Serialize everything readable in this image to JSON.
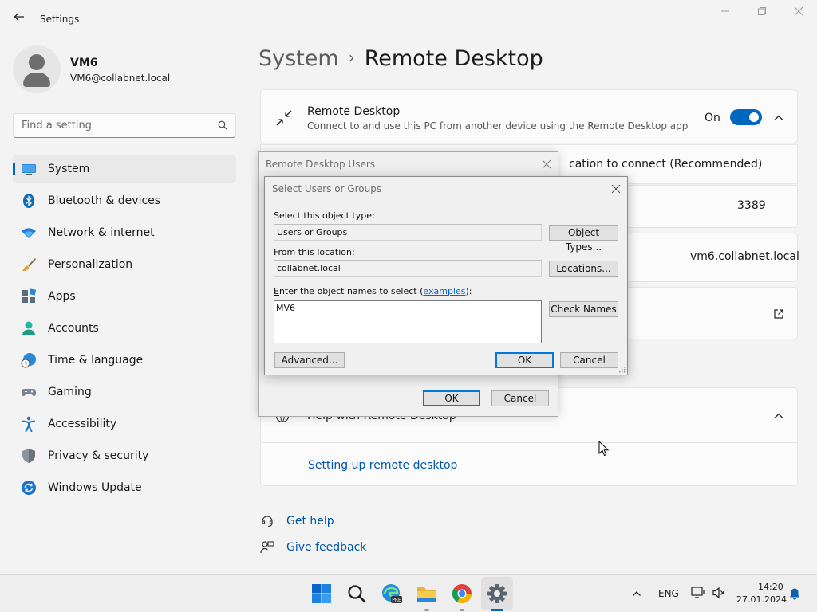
{
  "window": {
    "title": "Settings"
  },
  "profile": {
    "name": "VM6",
    "email": "VM6@collabnet.local"
  },
  "search": {
    "placeholder": "Find a setting"
  },
  "sidebar": {
    "items": [
      {
        "label": "System",
        "icon": "system-icon",
        "active": true
      },
      {
        "label": "Bluetooth & devices",
        "icon": "bluetooth-icon"
      },
      {
        "label": "Network & internet",
        "icon": "wifi-icon"
      },
      {
        "label": "Personalization",
        "icon": "brush-icon"
      },
      {
        "label": "Apps",
        "icon": "apps-icon"
      },
      {
        "label": "Accounts",
        "icon": "account-icon"
      },
      {
        "label": "Time & language",
        "icon": "clock-globe-icon"
      },
      {
        "label": "Gaming",
        "icon": "gamepad-icon"
      },
      {
        "label": "Accessibility",
        "icon": "accessibility-icon"
      },
      {
        "label": "Privacy & security",
        "icon": "shield-icon"
      },
      {
        "label": "Windows Update",
        "icon": "update-icon"
      }
    ]
  },
  "breadcrumb": {
    "parent": "System",
    "separator": "›",
    "current": "Remote Desktop"
  },
  "remote_desktop": {
    "title": "Remote Desktop",
    "description": "Connect to and use this PC from another device using the Remote Desktop app",
    "toggle_label": "On",
    "toggle_on": true
  },
  "rows": {
    "nla_partial": "cation to connect (Recommended)",
    "port": "3389",
    "pc_name": "vm6.collabnet.local"
  },
  "help_section": {
    "title_partial": "Help with Remote Desktop",
    "link": "Setting up remote desktop"
  },
  "help_links": {
    "get_help": "Get help",
    "give_feedback": "Give feedback"
  },
  "rdu_dialog": {
    "title": "Remote Desktop Users",
    "ok": "OK",
    "cancel": "Cancel"
  },
  "select_dialog": {
    "title": "Select Users or Groups",
    "object_type_label": "Select this object type:",
    "object_type_value": "Users or Groups",
    "object_types_button": "Object Types...",
    "location_label": "From this location:",
    "location_value": "collabnet.local",
    "locations_button": "Locations...",
    "names_label_u": "E",
    "names_label_rest": "nter the object names to select (",
    "names_label_link": "examples",
    "names_label_end": "):",
    "names_value": "MV6",
    "check_names_button": "Check Names",
    "advanced_button": "Advanced...",
    "ok": "OK",
    "cancel": "Cancel"
  },
  "taskbar": {
    "language": "ENG",
    "time": "14:20",
    "date": "27.01.2024",
    "edge_badge": "PRE"
  },
  "colors": {
    "accent": "#0067c0",
    "link": "#0055a8"
  }
}
